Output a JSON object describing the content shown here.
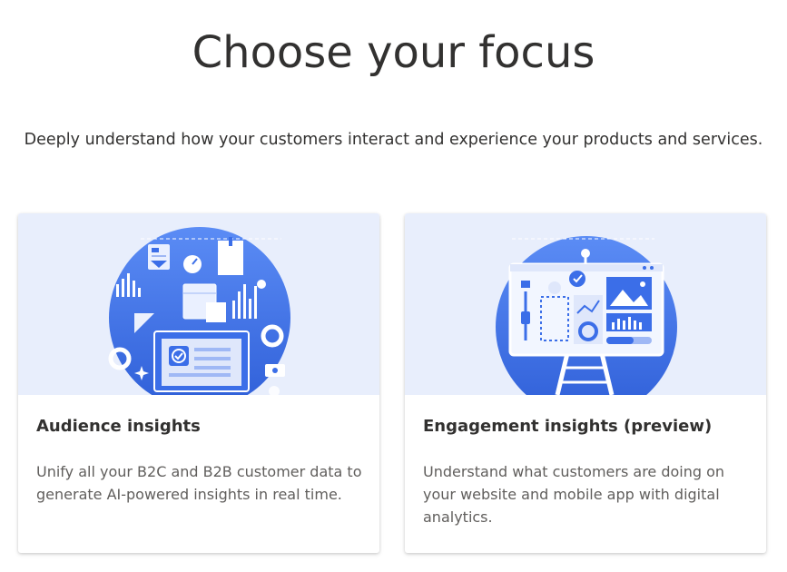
{
  "page": {
    "title": "Choose your focus",
    "subtitle": "Deeply understand how your customers interact and experience your products and services."
  },
  "cards": [
    {
      "heading": "Audience insights",
      "description": "Unify all your B2C and B2B customer data to generate AI-powered insights in real time.",
      "illustration_icon": "audience-insights-illustration"
    },
    {
      "heading": "Engagement insights (preview)",
      "description": "Understand what customers are doing on your website and mobile app with digital analytics.",
      "illustration_icon": "engagement-insights-illustration"
    }
  ],
  "colors": {
    "illustration_background": "#e8eefc",
    "accent_blue": "#3b6ee8",
    "title_text": "#323130",
    "body_text": "#605e5c"
  }
}
